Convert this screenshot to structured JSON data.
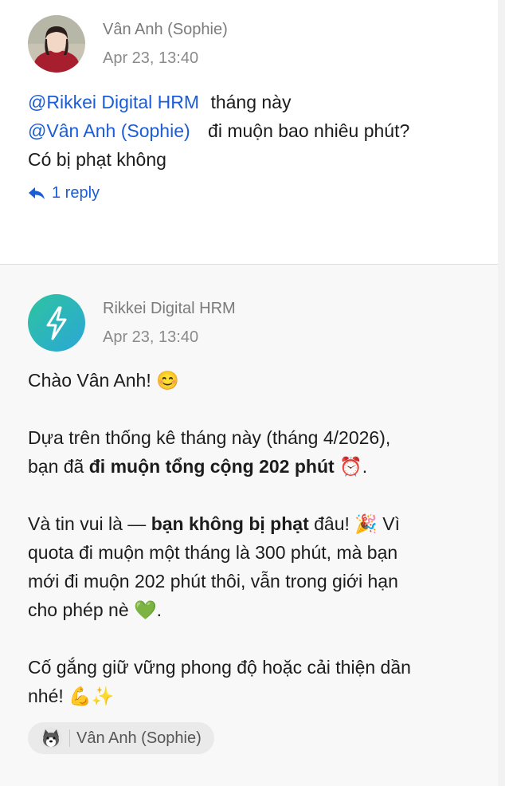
{
  "message1": {
    "sender": "Vân Anh (Sophie)",
    "time": "Apr 23, 13:40",
    "mention_bot": "@Rikkei Digital HRM",
    "text_after_bot": "tháng này",
    "mention_user": "@Vân Anh (Sophie)",
    "text_after_user": "đi muộn bao nhiêu phút?",
    "line3": "Có bị phạt không",
    "reply_label": "1 reply"
  },
  "message2": {
    "sender": "Rikkei Digital HRM",
    "time": "Apr 23, 13:40",
    "greeting": "Chào Vân Anh! 😊",
    "p1_line1": "Dựa trên thống kê tháng này (tháng 4/2026),",
    "p1_pre": "bạn đã ",
    "p1_bold": "đi muộn tổng cộng 202 phút",
    "p1_post": " ⏰.",
    "p2_pre": "Và tin vui là — ",
    "p2_bold": "bạn không bị phạt",
    "p2_post": " đâu! 🎉 Vì",
    "p2_line2": "quota đi muộn một tháng là 300 phút, mà bạn",
    "p2_line3": "mới đi muộn 202 phút thôi, vẫn trong giới hạn",
    "p2_line4": "cho phép nè 💚.",
    "p3_line1": "Cố gắng giữ vững phong độ hoặc cải thiện dần",
    "p3_line2": "nhé! 💪✨",
    "chip_label": "Vân Anh (Sophie)"
  },
  "icons": {
    "reply": "reply-arrow-icon",
    "bot_avatar": "lightning-bolt-icon",
    "chip_avatar": "husky-dog-icon"
  },
  "colors": {
    "mention": "#1b5dd6",
    "bot_avatar_gradient": [
      "#2ec4a0",
      "#2aa7d6"
    ]
  }
}
